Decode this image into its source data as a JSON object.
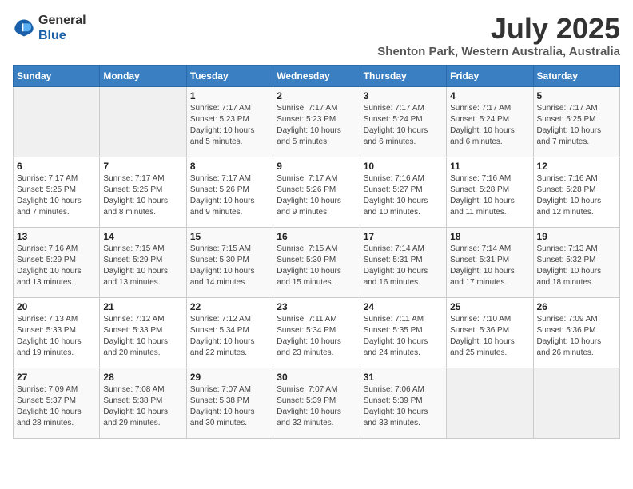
{
  "header": {
    "logo_line1": "General",
    "logo_line2": "Blue",
    "month_year": "July 2025",
    "location": "Shenton Park, Western Australia, Australia"
  },
  "days_of_week": [
    "Sunday",
    "Monday",
    "Tuesday",
    "Wednesday",
    "Thursday",
    "Friday",
    "Saturday"
  ],
  "weeks": [
    [
      {
        "day": "",
        "info": ""
      },
      {
        "day": "",
        "info": ""
      },
      {
        "day": "1",
        "info": "Sunrise: 7:17 AM\nSunset: 5:23 PM\nDaylight: 10 hours and 5 minutes."
      },
      {
        "day": "2",
        "info": "Sunrise: 7:17 AM\nSunset: 5:23 PM\nDaylight: 10 hours and 5 minutes."
      },
      {
        "day": "3",
        "info": "Sunrise: 7:17 AM\nSunset: 5:24 PM\nDaylight: 10 hours and 6 minutes."
      },
      {
        "day": "4",
        "info": "Sunrise: 7:17 AM\nSunset: 5:24 PM\nDaylight: 10 hours and 6 minutes."
      },
      {
        "day": "5",
        "info": "Sunrise: 7:17 AM\nSunset: 5:25 PM\nDaylight: 10 hours and 7 minutes."
      }
    ],
    [
      {
        "day": "6",
        "info": "Sunrise: 7:17 AM\nSunset: 5:25 PM\nDaylight: 10 hours and 7 minutes."
      },
      {
        "day": "7",
        "info": "Sunrise: 7:17 AM\nSunset: 5:25 PM\nDaylight: 10 hours and 8 minutes."
      },
      {
        "day": "8",
        "info": "Sunrise: 7:17 AM\nSunset: 5:26 PM\nDaylight: 10 hours and 9 minutes."
      },
      {
        "day": "9",
        "info": "Sunrise: 7:17 AM\nSunset: 5:26 PM\nDaylight: 10 hours and 9 minutes."
      },
      {
        "day": "10",
        "info": "Sunrise: 7:16 AM\nSunset: 5:27 PM\nDaylight: 10 hours and 10 minutes."
      },
      {
        "day": "11",
        "info": "Sunrise: 7:16 AM\nSunset: 5:28 PM\nDaylight: 10 hours and 11 minutes."
      },
      {
        "day": "12",
        "info": "Sunrise: 7:16 AM\nSunset: 5:28 PM\nDaylight: 10 hours and 12 minutes."
      }
    ],
    [
      {
        "day": "13",
        "info": "Sunrise: 7:16 AM\nSunset: 5:29 PM\nDaylight: 10 hours and 13 minutes."
      },
      {
        "day": "14",
        "info": "Sunrise: 7:15 AM\nSunset: 5:29 PM\nDaylight: 10 hours and 13 minutes."
      },
      {
        "day": "15",
        "info": "Sunrise: 7:15 AM\nSunset: 5:30 PM\nDaylight: 10 hours and 14 minutes."
      },
      {
        "day": "16",
        "info": "Sunrise: 7:15 AM\nSunset: 5:30 PM\nDaylight: 10 hours and 15 minutes."
      },
      {
        "day": "17",
        "info": "Sunrise: 7:14 AM\nSunset: 5:31 PM\nDaylight: 10 hours and 16 minutes."
      },
      {
        "day": "18",
        "info": "Sunrise: 7:14 AM\nSunset: 5:31 PM\nDaylight: 10 hours and 17 minutes."
      },
      {
        "day": "19",
        "info": "Sunrise: 7:13 AM\nSunset: 5:32 PM\nDaylight: 10 hours and 18 minutes."
      }
    ],
    [
      {
        "day": "20",
        "info": "Sunrise: 7:13 AM\nSunset: 5:33 PM\nDaylight: 10 hours and 19 minutes."
      },
      {
        "day": "21",
        "info": "Sunrise: 7:12 AM\nSunset: 5:33 PM\nDaylight: 10 hours and 20 minutes."
      },
      {
        "day": "22",
        "info": "Sunrise: 7:12 AM\nSunset: 5:34 PM\nDaylight: 10 hours and 22 minutes."
      },
      {
        "day": "23",
        "info": "Sunrise: 7:11 AM\nSunset: 5:34 PM\nDaylight: 10 hours and 23 minutes."
      },
      {
        "day": "24",
        "info": "Sunrise: 7:11 AM\nSunset: 5:35 PM\nDaylight: 10 hours and 24 minutes."
      },
      {
        "day": "25",
        "info": "Sunrise: 7:10 AM\nSunset: 5:36 PM\nDaylight: 10 hours and 25 minutes."
      },
      {
        "day": "26",
        "info": "Sunrise: 7:09 AM\nSunset: 5:36 PM\nDaylight: 10 hours and 26 minutes."
      }
    ],
    [
      {
        "day": "27",
        "info": "Sunrise: 7:09 AM\nSunset: 5:37 PM\nDaylight: 10 hours and 28 minutes."
      },
      {
        "day": "28",
        "info": "Sunrise: 7:08 AM\nSunset: 5:38 PM\nDaylight: 10 hours and 29 minutes."
      },
      {
        "day": "29",
        "info": "Sunrise: 7:07 AM\nSunset: 5:38 PM\nDaylight: 10 hours and 30 minutes."
      },
      {
        "day": "30",
        "info": "Sunrise: 7:07 AM\nSunset: 5:39 PM\nDaylight: 10 hours and 32 minutes."
      },
      {
        "day": "31",
        "info": "Sunrise: 7:06 AM\nSunset: 5:39 PM\nDaylight: 10 hours and 33 minutes."
      },
      {
        "day": "",
        "info": ""
      },
      {
        "day": "",
        "info": ""
      }
    ]
  ]
}
